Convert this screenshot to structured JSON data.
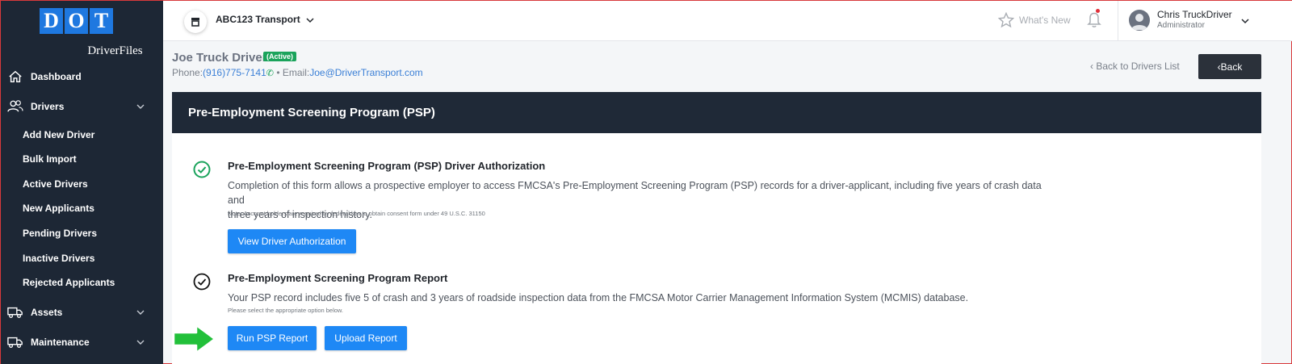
{
  "logo": {
    "letters": [
      "D",
      "O",
      "T"
    ],
    "subtitle": "DriverFiles"
  },
  "sidebar": {
    "items": [
      {
        "label": "Dashboard",
        "icon": "home-icon"
      },
      {
        "label": "Drivers",
        "icon": "users-icon"
      },
      {
        "label": "Assets",
        "icon": "truck-icon"
      },
      {
        "label": "Maintenance",
        "icon": "truck-icon"
      }
    ],
    "driver_subitems": [
      "Add New Driver",
      "Bulk Import",
      "Active Drivers",
      "New Applicants",
      "Pending Drivers",
      "Inactive Drivers",
      "Rejected Applicants"
    ]
  },
  "topbar": {
    "company": "ABC123 Transport",
    "whats_new": "What's New",
    "user_name": "Chris TruckDriver",
    "user_role": "Administrator"
  },
  "driver": {
    "name": "Joe Truck Driver",
    "status": "(Active)",
    "phone_label": "Phone:",
    "phone": "(916)775-7141",
    "email_label": "Email:",
    "email": "Joe@DriverTransport.com"
  },
  "nav": {
    "back_to_list": "Back to Drivers List",
    "back": "Back"
  },
  "page": {
    "title": "Pre-Employment Screening Program (PSP)",
    "sections": [
      {
        "title": "Pre-Employment Screening Program (PSP) Driver Authorization",
        "desc_line1": "Completion of this form allows a prospective employer to access FMCSA's Pre-Employment Screening Program (PSP) records for a driver-applicant, including five years of crash data and",
        "desc_line2": "three years of inspection history.",
        "note": "Note: Account holders are required by federal law to obtain consent form under 49 U.S.C. 31150",
        "button": "View Driver Authorization"
      },
      {
        "title": "Pre-Employment Screening Program Report",
        "desc_line1": "Your PSP record includes five 5 of crash and 3 years of roadside inspection data from the FMCSA Motor Carrier Management Information System (MCMIS) database.",
        "note": "Please select the appropriate option below.",
        "button_run": "Run PSP Report",
        "button_upload": "Upload Report"
      }
    ]
  },
  "colors": {
    "sidebar": "#1d2735",
    "accent": "#1e88f5",
    "success": "#1aa35b",
    "arrow": "#22c03a"
  }
}
